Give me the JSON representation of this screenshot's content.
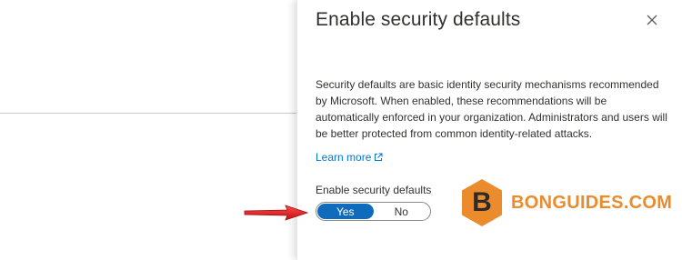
{
  "panel": {
    "title": "Enable security defaults",
    "close_icon": "close-icon",
    "description": "Security defaults are basic identity security mechanisms recommended by Microsoft. When enabled, these recommendations will be automatically enforced in your organization. Administrators and users will be better protected from common identity-related attacks.",
    "learn_more_label": "Learn more",
    "learn_more_icon": "external-link-icon",
    "toggle_label": "Enable security defaults",
    "toggle": {
      "options": [
        "Yes",
        "No"
      ],
      "selected": "Yes"
    }
  },
  "annotation": {
    "arrow_icon": "red-arrow-icon",
    "arrow_color": "#e3151a"
  },
  "watermark": {
    "logo_letter": "B",
    "text": "BONGUIDES.COM",
    "logo_color": "#ea8b2c"
  },
  "colors": {
    "accent": "#0f6cbd",
    "link": "#0078d4",
    "text": "#323130"
  }
}
